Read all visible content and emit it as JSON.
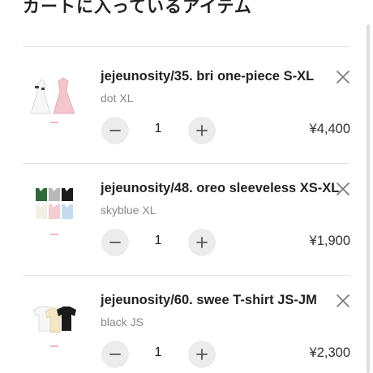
{
  "page": {
    "title": "カートに入っているアイテム"
  },
  "colors": {
    "accent_text": "#222222",
    "muted_text": "#888888",
    "button_bg": "#ececec",
    "divider": "#e2e2e2"
  },
  "icons": {
    "remove": "close-icon",
    "decrease": "minus-icon",
    "increase": "plus-icon"
  },
  "cart": {
    "items": [
      {
        "name": "jejeunosity/35. bri one-piece S-XL",
        "variant": "dot XL",
        "quantity": "1",
        "price": "¥4,400"
      },
      {
        "name": "jejeunosity/48. oreo sleeveless XS-XL",
        "variant": "skyblue XL",
        "quantity": "1",
        "price": "¥1,900"
      },
      {
        "name": "jejeunosity/60. swee T-shirt JS-JM",
        "variant": "black JS",
        "quantity": "1",
        "price": "¥2,300"
      }
    ]
  }
}
